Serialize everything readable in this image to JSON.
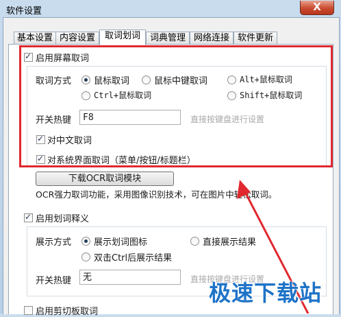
{
  "window": {
    "title": "软件设置",
    "close_label": "X"
  },
  "tabs": [
    {
      "label": "基本设置"
    },
    {
      "label": "内容设置"
    },
    {
      "label": "取词划词",
      "active": true
    },
    {
      "label": "词典管理"
    },
    {
      "label": "网络连接"
    },
    {
      "label": "软件更新"
    }
  ],
  "screen_capture": {
    "enable_label": "启用屏幕取词",
    "enable_checked": true,
    "method_label": "取词方式",
    "methods": [
      {
        "label": "鼠标取词",
        "selected": true
      },
      {
        "label": "鼠标中键取词",
        "selected": false
      },
      {
        "label": "Alt+鼠标取词",
        "selected": false
      },
      {
        "label": "Ctrl+鼠标取词",
        "selected": false
      },
      {
        "label": "Shift+鼠标取词",
        "selected": false
      }
    ],
    "hotkey_label": "开关热键",
    "hotkey_value": "F8",
    "hotkey_hint": "直接按键盘进行设置",
    "chinese_label": "对中文取词",
    "chinese_checked": true,
    "ui_label": "对系统界面取词（菜单/按钮/标题栏）",
    "ui_checked": true
  },
  "ocr": {
    "button_label": "下载OCR取词模块",
    "description": "OCR强力取词功能，采用图像识别技术，可在图片中轻松取词。"
  },
  "selection": {
    "enable_label": "启用划词释义",
    "enable_checked": true,
    "display_label": "展示方式",
    "modes": [
      {
        "label": "展示划词图标",
        "selected": true
      },
      {
        "label": "直接展示结果",
        "selected": false
      },
      {
        "label": "双击Ctrl后展示结果",
        "selected": false
      }
    ],
    "hotkey_label": "开关热键",
    "hotkey_value": "无",
    "hotkey_hint": "直接按键盘进行设置"
  },
  "clipboard": {
    "enable_label": "启用剪切板取词",
    "enable_checked": false
  },
  "watermark": {
    "text": "极速下载站"
  },
  "colors": {
    "highlight_box": "#e0282e",
    "arrow": "#e0282e",
    "watermark": "#1e73c8"
  }
}
